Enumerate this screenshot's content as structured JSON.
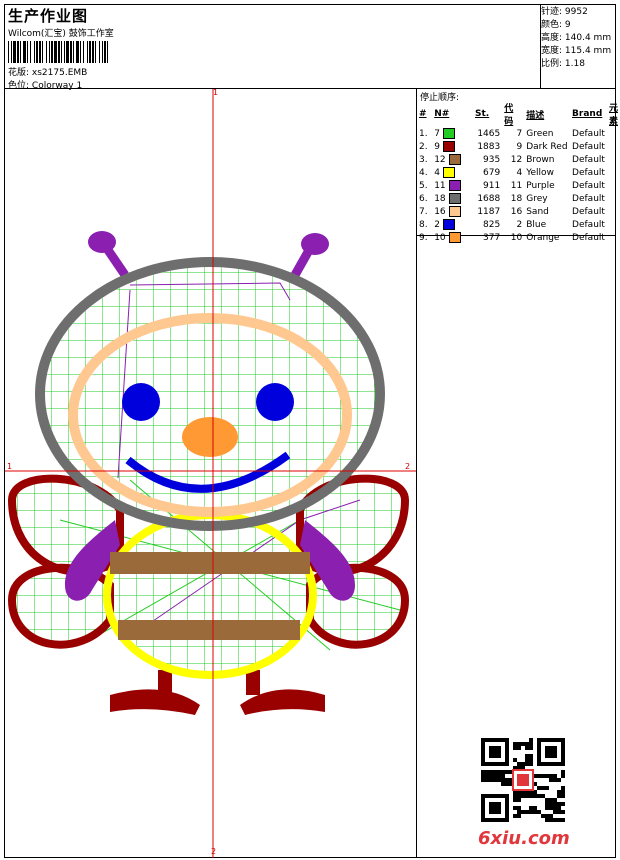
{
  "header": {
    "title": "生产作业图",
    "company": "Wilcom(汇宝) 鼓饰工作室",
    "design_label": "花版:",
    "design_value": "xs2175.EMB",
    "color_label": "色位:",
    "color_value": "Colorway 1"
  },
  "stats": {
    "stitches_label": "针迹:",
    "stitches_value": "9952",
    "colors_label": "颜色:",
    "colors_value": "9",
    "height_label": "高度:",
    "height_value": "140.4 mm",
    "width_label": "宽度:",
    "width_value": "115.4 mm",
    "ratio_label": "比例:",
    "ratio_value": "1.18"
  },
  "sequence": {
    "title": "停止顺序:",
    "headers": [
      "#",
      "N#",
      "St.",
      "代码",
      "描述",
      "Brand",
      "元素"
    ],
    "rows": [
      {
        "n": "1.",
        "code_n": "7",
        "color": "#22cc22",
        "st": "1465",
        "code": "7",
        "desc": "Green",
        "brand": "Default"
      },
      {
        "n": "2.",
        "code_n": "9",
        "color": "#990000",
        "st": "1883",
        "code": "9",
        "desc": "Dark Red",
        "brand": "Default"
      },
      {
        "n": "3.",
        "code_n": "12",
        "color": "#9a6a3a",
        "st": "935",
        "code": "12",
        "desc": "Brown",
        "brand": "Default"
      },
      {
        "n": "4.",
        "code_n": "4",
        "color": "#ffff00",
        "st": "679",
        "code": "4",
        "desc": "Yellow",
        "brand": "Default"
      },
      {
        "n": "5.",
        "code_n": "11",
        "color": "#8a1fb0",
        "st": "911",
        "code": "11",
        "desc": "Purple",
        "brand": "Default"
      },
      {
        "n": "6.",
        "code_n": "18",
        "color": "#6e6e6e",
        "st": "1688",
        "code": "18",
        "desc": "Grey",
        "brand": "Default"
      },
      {
        "n": "7.",
        "code_n": "16",
        "color": "#ffc890",
        "st": "1187",
        "code": "16",
        "desc": "Sand",
        "brand": "Default"
      },
      {
        "n": "8.",
        "code_n": "2",
        "color": "#0000dd",
        "st": "825",
        "code": "2",
        "desc": "Blue",
        "brand": "Default"
      },
      {
        "n": "9.",
        "code_n": "10",
        "color": "#ff9933",
        "st": "377",
        "code": "10",
        "desc": "Orange",
        "brand": "Default"
      }
    ]
  },
  "axes": {
    "top": "1",
    "bottom": "2",
    "left": "1",
    "right": "2"
  },
  "watermark": "6xiu.com"
}
